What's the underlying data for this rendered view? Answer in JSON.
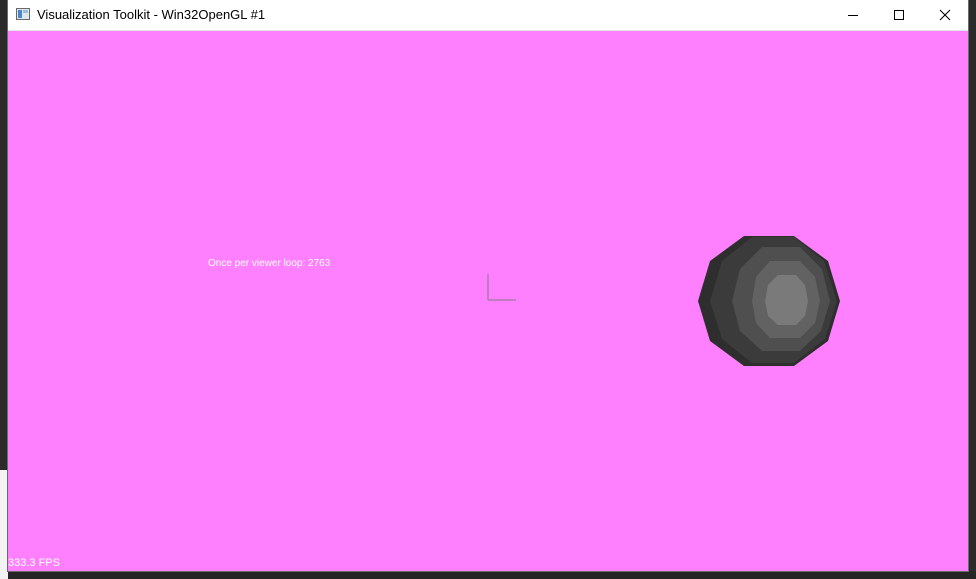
{
  "window": {
    "title": "Visualization Toolkit - Win32OpenGL #1",
    "controls": {
      "minimize": "minimize-icon",
      "maximize": "maximize-icon",
      "close": "close-icon"
    }
  },
  "viewport": {
    "background_color": "#ff80ff",
    "text_overlay": "Once per viewer loop: 2763",
    "fps": "333.3 FPS",
    "axes_icon": "axes-icon",
    "sphere_icon": "sphere-icon"
  },
  "colors": {
    "sphere_outer": "#2e2e2e",
    "sphere_mid": "#4a4a4a",
    "sphere_inner": "#626262",
    "sphere_core": "#7a7a7a",
    "axes": "#9b7a9b"
  }
}
